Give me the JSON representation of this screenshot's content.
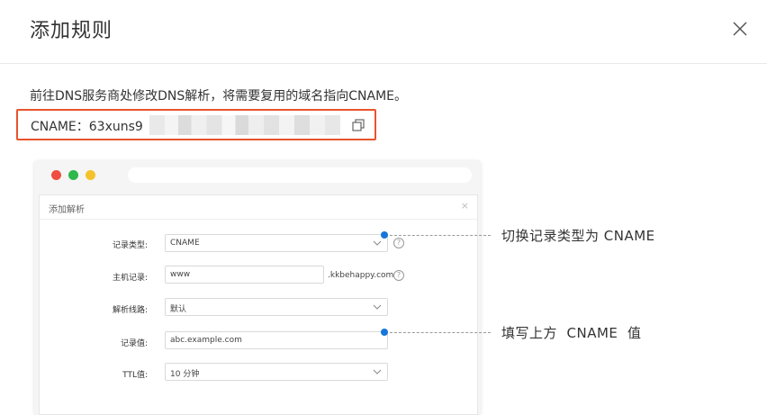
{
  "dialog": {
    "title": "添加规则",
    "description": "前往DNS服务商处修改DNS解析，将需要复用的域名指向CNAME。",
    "cname_label": "CNAME：63xuns9"
  },
  "icons": {
    "close": "close-icon",
    "copy": "copy-icon"
  },
  "mock": {
    "panel_title": "添加解析",
    "panel_close": "×",
    "rows": [
      {
        "label": "记录类型:",
        "value": "CNAME"
      },
      {
        "label": "主机记录:",
        "value": "www",
        "suffix": ".kkbehappy.com"
      },
      {
        "label": "解析线路:",
        "value": "默认"
      },
      {
        "label": "记录值:",
        "value": "abc.example.com"
      },
      {
        "label": "TTL值:",
        "value": "10 分钟"
      }
    ],
    "help_glyph": "?"
  },
  "callouts": {
    "first": "切换记录类型为 CNAME",
    "second": "填写上方  CNAME  值"
  },
  "colors": {
    "highlight_border": "#e8542c",
    "callout_dot": "#1677d9",
    "mac_red": "#ee4d3f",
    "mac_green": "#2cb84a",
    "mac_yellow": "#f4c22b"
  }
}
